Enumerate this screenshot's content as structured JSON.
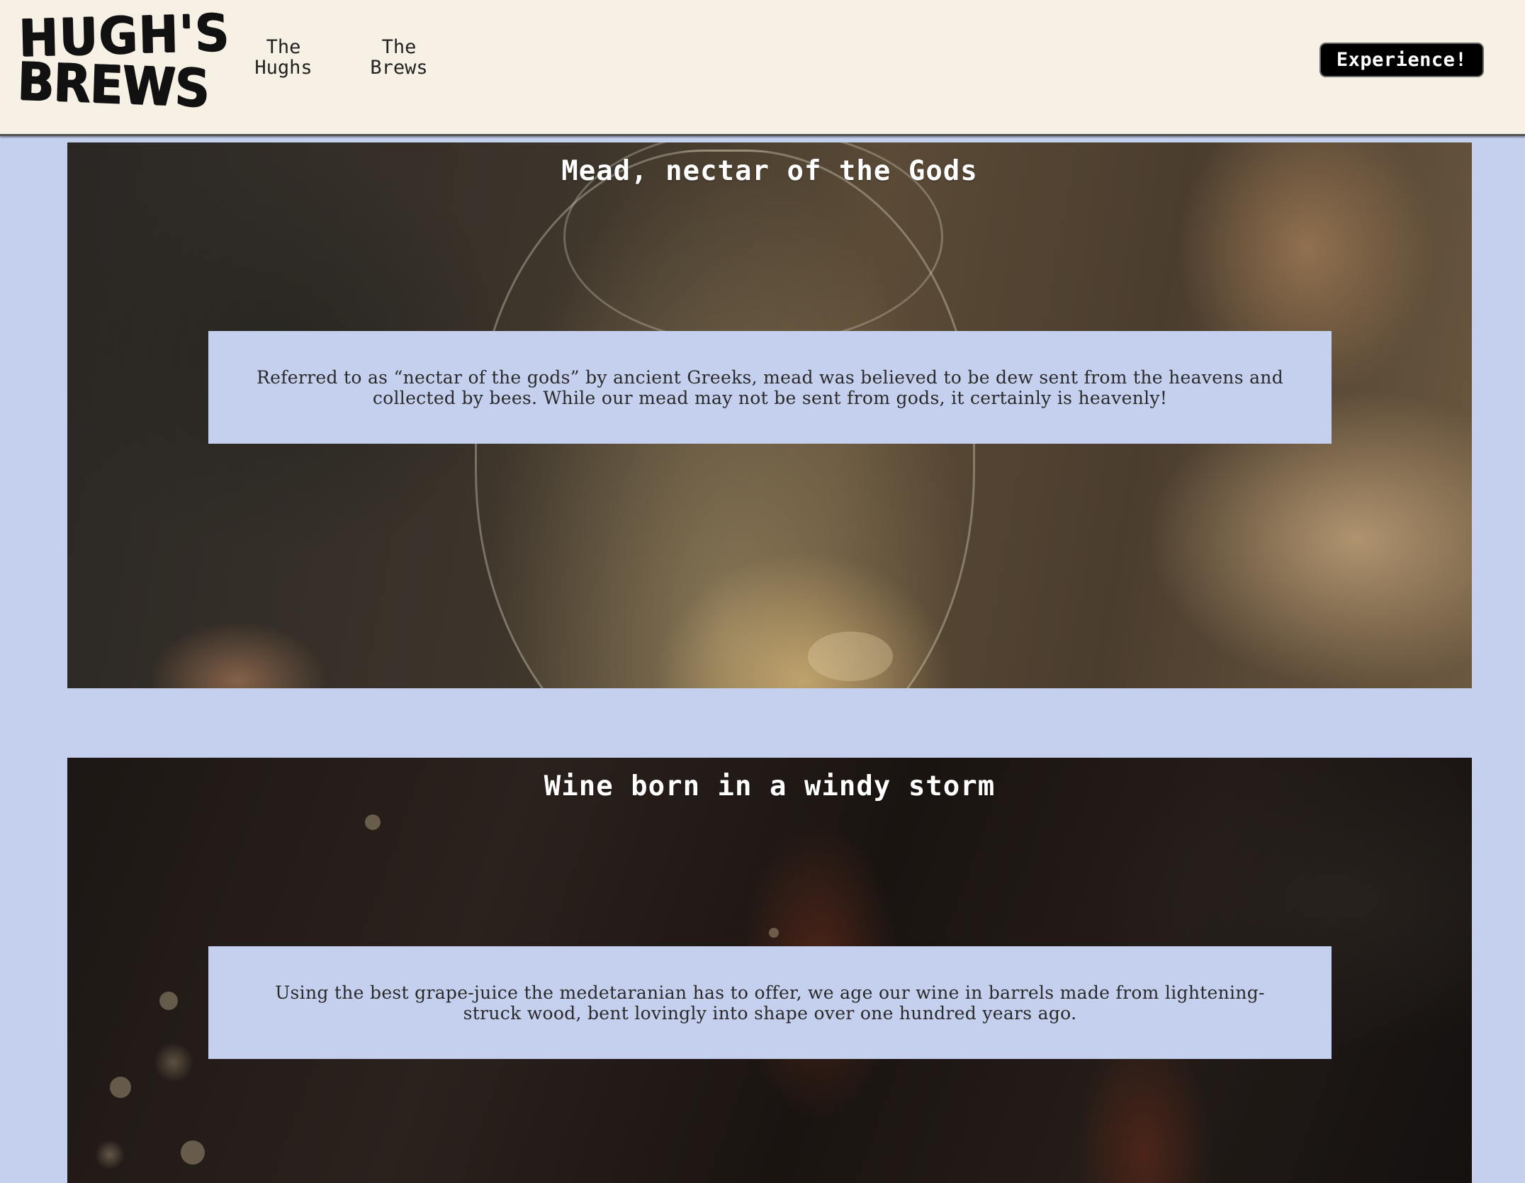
{
  "header": {
    "logo_line1": "HUGH'S",
    "logo_line2": "BREWS",
    "nav": [
      {
        "line1": "The",
        "line2": "Hughs"
      },
      {
        "line1": "The",
        "line2": "Brews"
      }
    ],
    "cta_label": "Experience!"
  },
  "sections": [
    {
      "title": "Mead, nectar of the Gods",
      "text": "Referred to as “nectar of the gods” by ancient Greeks, mead was believed to be dew sent from the heavens and collected by bees. While our mead may not be sent from gods, it certainly is heavenly!"
    },
    {
      "title": "Wine born in a windy storm",
      "text": "Using the best grape-juice the medetaranian has to offer, we age our wine in barrels made from lightening-struck wood, bent lovingly into shape over one hundred years ago."
    }
  ],
  "colors": {
    "header_bg": "#f7f0e5",
    "page_bg": "#c4d0ee",
    "caption_bg": "#c4d0ee",
    "cta_bg": "#000000",
    "cta_text": "#ffffff"
  }
}
